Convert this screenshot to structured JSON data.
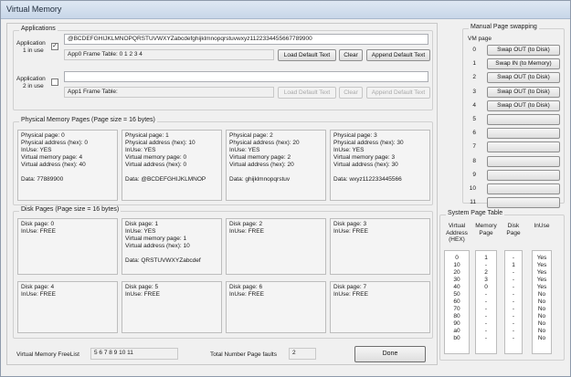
{
  "window": {
    "title": "Virtual Memory"
  },
  "applications": {
    "label": "Applications",
    "app1": {
      "label_line1": "Application",
      "label_line2": "1 in use",
      "checked": "✓",
      "data_value": "@BCDEFGHIJKLMNOPQRSTUVWXYZabcdefghijklmnopqrstuvwxyz1122334455667789900",
      "frame_table": "App0 Frame Table: 0 1 2 3 4",
      "load_label": "Load Default Text",
      "clear_label": "Clear",
      "append_label": "Append Default Text"
    },
    "app2": {
      "label_line1": "Application",
      "label_line2": "2 in use",
      "data_value": "",
      "frame_table": "App1 Frame Table:",
      "load_label": "Load Default Text",
      "clear_label": "Clear",
      "append_label": "Append Default Text"
    }
  },
  "physical": {
    "label": "Physical Memory Pages  (Page size = 16 bytes)",
    "pages": [
      {
        "l1": "Physical page: 0",
        "l2": "Physical address (hex): 0",
        "l3": "InUse: YES",
        "l4": "Virtual memory page: 4",
        "l5": "Virtual address (hex): 40",
        "data": "Data:  77889900"
      },
      {
        "l1": "Physical page: 1",
        "l2": "Physical address (hex): 10",
        "l3": "InUse: YES",
        "l4": "Virtual memory page: 0",
        "l5": "Virtual address (hex): 0",
        "data": "Data:  @BCDEFGHIJKLMNOP"
      },
      {
        "l1": "Physical page: 2",
        "l2": "Physical address (hex): 20",
        "l3": "InUse: YES",
        "l4": "Virtual memory page: 2",
        "l5": "Virtual address (hex): 20",
        "data": "Data:  ghijklmnopqrstuv"
      },
      {
        "l1": "Physical page: 3",
        "l2": "Physical address (hex): 30",
        "l3": "InUse: YES",
        "l4": "Virtual memory page: 3",
        "l5": "Virtual address (hex): 30",
        "data": "Data:  wxyz112233445566"
      }
    ]
  },
  "disk": {
    "label": "Disk Pages  (Page size = 16 bytes)",
    "pages": [
      {
        "l1": "Disk page: 0",
        "l2": "InUse: FREE",
        "l3": "",
        "l4": "",
        "data": ""
      },
      {
        "l1": "Disk page: 1",
        "l2": "InUse: YES",
        "l3": "Virtual memory page: 1",
        "l4": "Virtual address (hex): 10",
        "data": "Data:  QRSTUVWXYZabcdef"
      },
      {
        "l1": "Disk page: 2",
        "l2": "InUse: FREE",
        "l3": "",
        "l4": "",
        "data": ""
      },
      {
        "l1": "Disk page: 3",
        "l2": "InUse: FREE",
        "l3": "",
        "l4": "",
        "data": ""
      },
      {
        "l1": "Disk page: 4",
        "l2": "InUse: FREE",
        "l3": "",
        "l4": "",
        "data": ""
      },
      {
        "l1": "Disk page: 5",
        "l2": "InUse: FREE",
        "l3": "",
        "l4": "",
        "data": ""
      },
      {
        "l1": "Disk page: 6",
        "l2": "InUse: FREE",
        "l3": "",
        "l4": "",
        "data": ""
      },
      {
        "l1": "Disk page: 7",
        "l2": "InUse: FREE",
        "l3": "",
        "l4": "",
        "data": ""
      }
    ]
  },
  "manual_swap": {
    "label": "Manual Page swapping",
    "vm_page_header": "VM page",
    "rows": [
      {
        "num": "0",
        "button": "Swap OUT (to Disk)"
      },
      {
        "num": "1",
        "button": "Swap IN (to Memory)"
      },
      {
        "num": "2",
        "button": "Swap OUT (to Disk)"
      },
      {
        "num": "3",
        "button": "Swap OUT (to Disk)"
      },
      {
        "num": "4",
        "button": "Swap OUT (to Disk)"
      },
      {
        "num": "5",
        "button": ""
      },
      {
        "num": "6",
        "button": ""
      },
      {
        "num": "7",
        "button": ""
      },
      {
        "num": "8",
        "button": ""
      },
      {
        "num": "9",
        "button": ""
      },
      {
        "num": "10",
        "button": ""
      },
      {
        "num": "11",
        "button": ""
      }
    ]
  },
  "system_page_table": {
    "label": "System Page Table",
    "headers": {
      "vaddr": [
        "Virtual",
        "Address",
        "(HEX)"
      ],
      "mem": [
        "Memory",
        "Page"
      ],
      "disk": [
        "Disk",
        "Page"
      ],
      "inuse": [
        "InUse"
      ]
    },
    "vaddr": [
      "0",
      "10",
      "20",
      "30",
      "40",
      "50",
      "60",
      "70",
      "80",
      "90",
      "a0",
      "b0"
    ],
    "mem": [
      "1",
      "-",
      "2",
      "3",
      "0",
      "-",
      "-",
      "-",
      "-",
      "-",
      "-",
      "-"
    ],
    "disk": [
      "-",
      "1",
      "-",
      "-",
      "-",
      "-",
      "-",
      "-",
      "-",
      "-",
      "-",
      "-"
    ],
    "inuse": [
      "Yes",
      "Yes",
      "Yes",
      "Yes",
      "Yes",
      "No",
      "No",
      "No",
      "No",
      "No",
      "No",
      "No"
    ]
  },
  "footer": {
    "freelist_label": "Virtual Memory FreeList",
    "freelist_value": "5 6 7 8 9 10 11",
    "faults_label": "Total Number Page faults",
    "faults_value": "2",
    "done_label": "Done"
  }
}
